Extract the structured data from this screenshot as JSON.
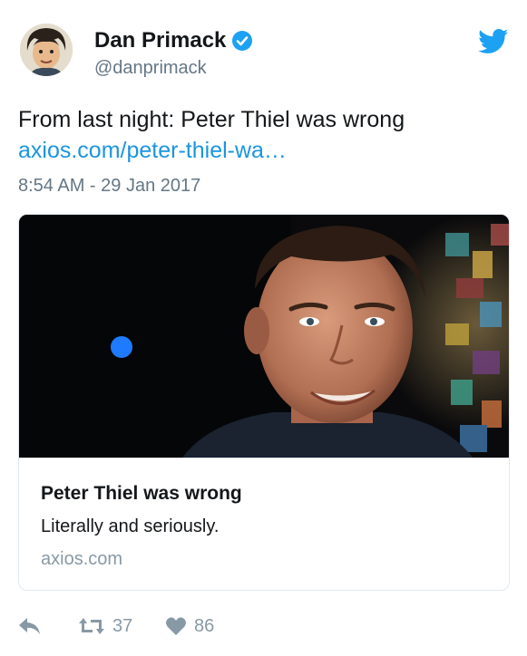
{
  "author": {
    "display_name": "Dan Primack",
    "handle": "@danprimack",
    "verified": true
  },
  "tweet": {
    "text": "From last night: Peter Thiel was wrong",
    "link_text": "axios.com/peter-thiel-wa…",
    "timestamp": "8:54 AM - 29 Jan 2017"
  },
  "card": {
    "title": "Peter Thiel was wrong",
    "description": "Literally and seriously.",
    "domain": "axios.com"
  },
  "actions": {
    "retweets": "37",
    "likes": "86"
  },
  "icons": {
    "brand": "twitter-bird-icon",
    "verified": "verified-badge-icon",
    "reply": "reply-icon",
    "retweet": "retweet-icon",
    "like": "heart-icon"
  },
  "colors": {
    "link": "#1b95e0",
    "secondary_text": "#657786",
    "action_icon": "#8899a6",
    "brand": "#1da1f2"
  }
}
